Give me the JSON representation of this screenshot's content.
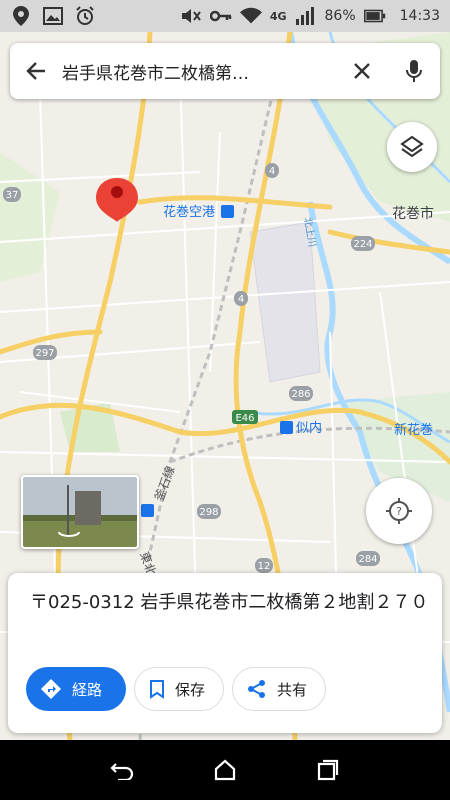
{
  "status": {
    "battery": "86%",
    "time": "14:33",
    "network": "4G"
  },
  "search": {
    "query": "岩手県花巻市二枚橋第…"
  },
  "map_labels": {
    "airport": "花巻空港",
    "city": "花巻市",
    "station_niinai": "似内",
    "station_shin_hanamaki": "新花巻",
    "kamaishi_line": "釜石線",
    "tohoku_line": "東北本",
    "river": "北上川",
    "route_37": "37",
    "route_4a": "4",
    "route_4b": "4",
    "route_224": "224",
    "route_297": "297",
    "route_286": "286",
    "route_e46": "E46",
    "route_298": "298",
    "route_12": "12",
    "route_284": "284"
  },
  "place": {
    "address": "〒025-0312 岩手県花巻市二枚橋第２地割２７０"
  },
  "actions": {
    "directions": "経路",
    "save": "保存",
    "share": "共有"
  },
  "colors": {
    "accent": "#1a73e8",
    "pin": "#ea4335",
    "highway": "#f6cf65",
    "water": "#aadaff"
  }
}
